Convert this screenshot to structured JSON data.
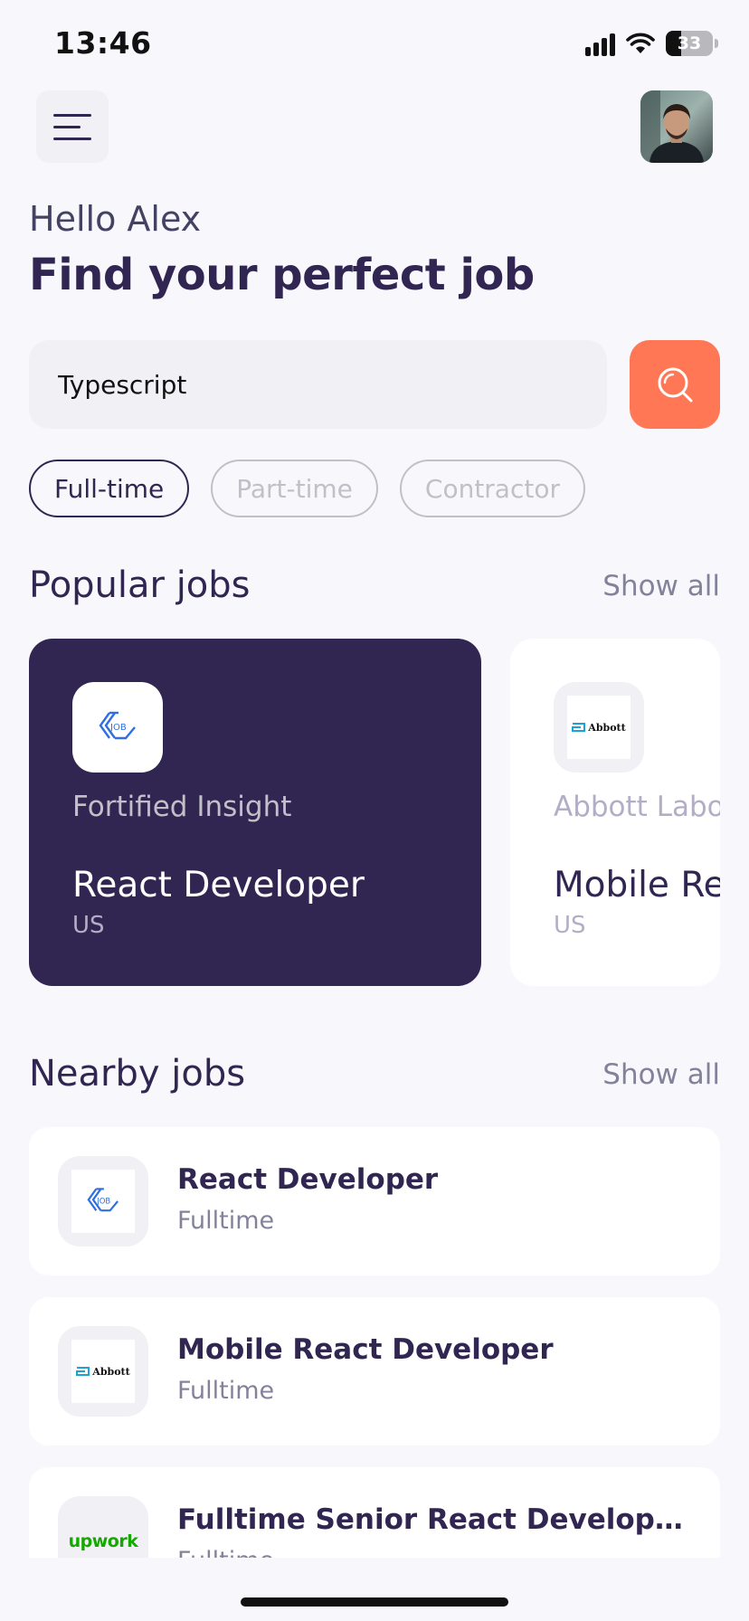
{
  "status_bar": {
    "time": "13:46",
    "battery": "33",
    "battery_level": 0.33
  },
  "header": {
    "menu_icon": "menu-icon",
    "avatar": "user-avatar"
  },
  "welcome": {
    "greeting": "Hello Alex",
    "headline": "Find your perfect job"
  },
  "search": {
    "value": "Typescript",
    "button_icon": "search-icon"
  },
  "job_types": [
    {
      "label": "Full-time",
      "active": true
    },
    {
      "label": "Part-time",
      "active": false
    },
    {
      "label": "Contractor",
      "active": false
    }
  ],
  "popular": {
    "title": "Popular jobs",
    "show_all": "Show all",
    "cards": [
      {
        "company": "Fortified Insight",
        "title": "React Developer",
        "location": "US",
        "logo": "job-logo"
      },
      {
        "company": "Abbott Labo",
        "title": "Mobile Re",
        "location": "US",
        "logo": "abbott-logo"
      }
    ]
  },
  "nearby": {
    "title": "Nearby jobs",
    "show_all": "Show all",
    "jobs": [
      {
        "title": "React Developer",
        "type": "Fulltime",
        "logo": "job-logo"
      },
      {
        "title": "Mobile React Developer",
        "type": "Fulltime",
        "logo": "abbott-logo"
      },
      {
        "title": "Fulltime Senior React Developer (...",
        "type": "Fulltime",
        "logo": "upwork-logo"
      }
    ]
  },
  "logos": {
    "abbott_text": "Abbott",
    "upwork_text": "upwork"
  },
  "colors": {
    "background": "#F8F8FC",
    "primary": "#312651",
    "accent": "#FF7754",
    "gray": "#83829A",
    "light_gray": "#C1C0C8",
    "card_white": "#FFFFFF"
  }
}
